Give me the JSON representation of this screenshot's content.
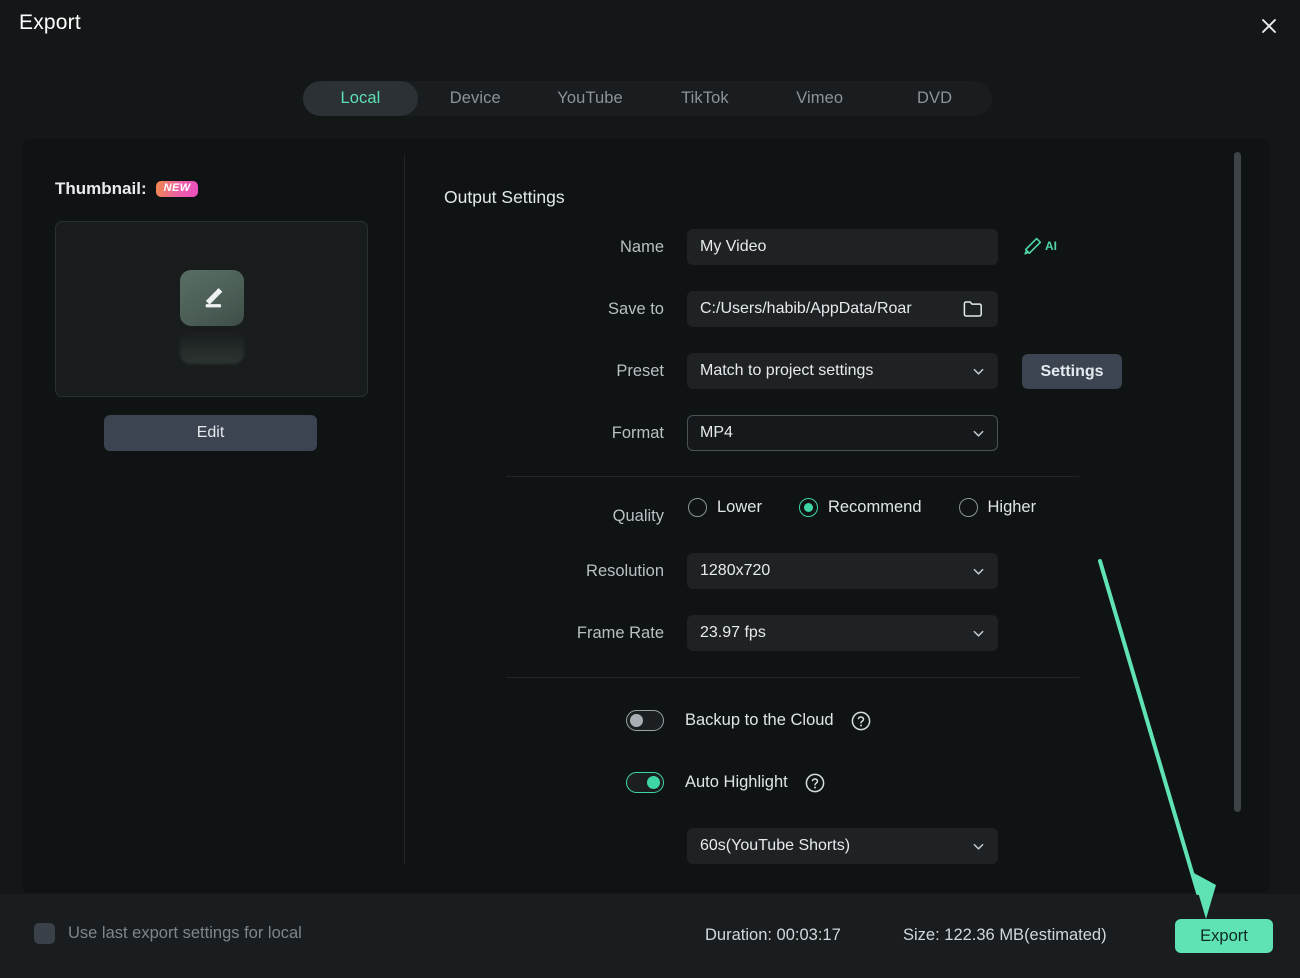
{
  "window": {
    "title": "Export",
    "close_icon": "close-icon"
  },
  "tabs": [
    {
      "label": "Local",
      "active": true
    },
    {
      "label": "Device",
      "active": false
    },
    {
      "label": "YouTube",
      "active": false
    },
    {
      "label": "TikTok",
      "active": false
    },
    {
      "label": "Vimeo",
      "active": false
    },
    {
      "label": "DVD",
      "active": false
    }
  ],
  "thumbnail": {
    "label": "Thumbnail:",
    "badge": "NEW",
    "preview_icon": "pencil-edit-icon",
    "edit_label": "Edit"
  },
  "output": {
    "heading": "Output Settings",
    "name": {
      "label": "Name",
      "value": "My Video"
    },
    "ai_rename": {
      "icon": "ai-pen-icon",
      "text": "AI"
    },
    "save_to": {
      "label": "Save to",
      "value": "C:/Users/habib/AppData/Roar",
      "folder_icon": "folder-icon"
    },
    "preset": {
      "label": "Preset",
      "value": "Match to project settings"
    },
    "settings_button": "Settings",
    "format": {
      "label": "Format",
      "value": "MP4"
    },
    "quality": {
      "label": "Quality",
      "options": [
        "Lower",
        "Recommend",
        "Higher"
      ],
      "selected": "Recommend"
    },
    "resolution": {
      "label": "Resolution",
      "value": "1280x720"
    },
    "frame_rate": {
      "label": "Frame Rate",
      "value": "23.97 fps"
    },
    "backup_cloud": {
      "label": "Backup to the Cloud",
      "on": false,
      "help_icon": "help-circle-icon"
    },
    "auto_highlight": {
      "label": "Auto Highlight",
      "on": true,
      "help_icon": "help-circle-icon"
    },
    "highlight_length": {
      "value": "60s(YouTube Shorts)"
    }
  },
  "footer": {
    "use_last_settings": "Use last export settings for local",
    "duration": "Duration: 00:03:17",
    "size": "Size: 122.36 MB(estimated)",
    "export_label": "Export"
  },
  "colors": {
    "accent": "#5fe3b5",
    "accent_radio": "#3fd6a5",
    "badge_start": "#f08a4b",
    "badge_end": "#e94ec0",
    "panel_bg": "#101314",
    "window_bg": "#141718",
    "footer_bg": "#191d1f",
    "annotation_arrow": "#5fe3b5"
  }
}
